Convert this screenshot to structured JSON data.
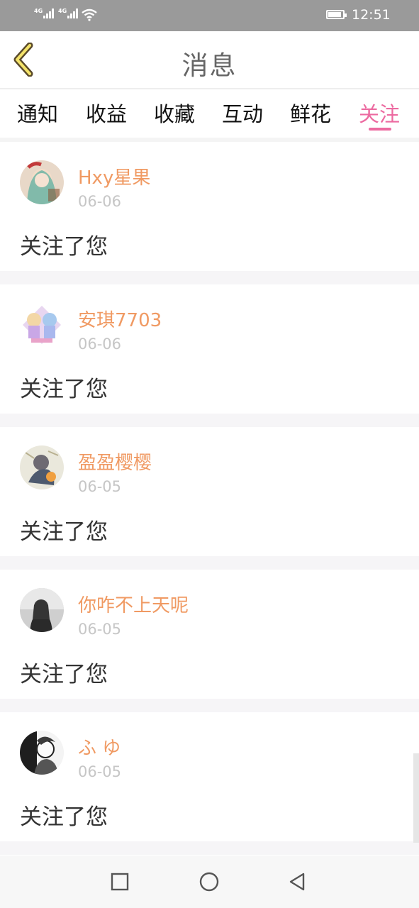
{
  "status_bar": {
    "signal1": "4G",
    "signal2": "4G",
    "time": "12:51",
    "icons": [
      "signal-icon",
      "signal-icon",
      "wifi-icon",
      "battery-icon"
    ]
  },
  "header": {
    "back_icon": "chevron-left-icon",
    "title": "消息"
  },
  "tabs": [
    {
      "label": "通知",
      "active": false
    },
    {
      "label": "收益",
      "active": false
    },
    {
      "label": "收藏",
      "active": false
    },
    {
      "label": "互动",
      "active": false
    },
    {
      "label": "鲜花",
      "active": false
    },
    {
      "label": "关注",
      "active": true
    }
  ],
  "colors": {
    "accent": "#ec6aa0",
    "username": "#f09a63",
    "date": "#c6c6c6",
    "status_bar": "#9a9a9a"
  },
  "messages": [
    {
      "username": "Hxy星果",
      "date": "06-06",
      "text": "关注了您"
    },
    {
      "username": "安琪7703",
      "date": "06-06",
      "text": "关注了您"
    },
    {
      "username": "盈盈樱樱",
      "date": "06-05",
      "text": "关注了您"
    },
    {
      "username": "你咋不上天呢",
      "date": "06-05",
      "text": "关注了您"
    },
    {
      "username": "ふ ゆ",
      "date": "06-05",
      "text": "关注了您"
    }
  ],
  "nav_bar": {
    "icons": [
      "square-icon",
      "circle-icon",
      "triangle-back-icon"
    ]
  }
}
